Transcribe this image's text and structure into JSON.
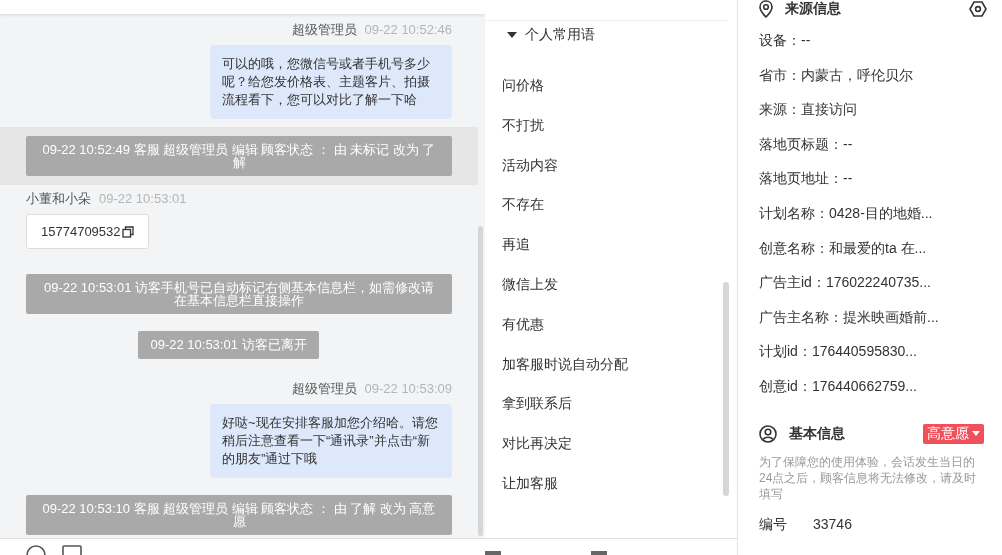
{
  "messages": [
    {
      "kind": "agent",
      "sender": "超级管理员",
      "time": "09-22 10:52:46",
      "text": "可以的哦，您微信号或者手机号多少呢？给您发价格表、主题客片、拍摄流程看下，您可以对比了解一下哈"
    },
    {
      "kind": "system",
      "highlighted": true,
      "text": "09-22 10:52:49 客服 超级管理员 编辑 顾客状态 ： 由 未标记 改为 了解"
    },
    {
      "kind": "visitor",
      "sender": "小董和小朵",
      "time": "09-22 10:53:01",
      "phone": "15774709532"
    },
    {
      "kind": "system",
      "highlighted": false,
      "text": "09-22 10:53:01 访客手机号已自动标记右侧基本信息栏，如需修改请在基本信息栏直接操作"
    },
    {
      "kind": "notice",
      "text": "09-22 10:53:01 访客已离开"
    },
    {
      "kind": "agent",
      "sender": "超级管理员",
      "time": "09-22 10:53:09",
      "text": "好哒~现在安排客服加您介绍哈。请您稍后注意查看一下“通讯录”并点击“新的朋友”通过下哦"
    },
    {
      "kind": "system",
      "highlighted": false,
      "text": "09-22 10:53:10 客服 超级管理员 编辑 顾客状态 ： 由 了解 改为 高意愿"
    }
  ],
  "phrases": {
    "title": "个人常用语",
    "expanded": true,
    "items": [
      "问价格",
      "不打扰",
      "活动内容",
      "不存在",
      "再追",
      "微信上发",
      "有优惠",
      "加客服时说自动分配",
      "拿到联系后",
      "对比再决定",
      "让加客服"
    ]
  },
  "source_info": {
    "title": "来源信息",
    "fields": [
      "设备：--",
      "省市：内蒙古，呼伦贝尔",
      "来源：直接访问",
      "落地页标题：--",
      "落地页地址：--",
      "计划名称：0428-目的地婚...",
      "创意名称：和最爱的ta 在...",
      "广告主id：176022240735...",
      "广告主名称：提米映画婚前...",
      "计划id：176440595830...",
      "创意id：176440662759..."
    ]
  },
  "basic_info": {
    "title": "基本信息",
    "status": {
      "label": "高意愿",
      "color": "#f0505a"
    },
    "note": "为了保障您的使用体验，会话发生当日的24点之后，顾客信息将无法修改，请及时填写",
    "fields": [
      {
        "label": "编号",
        "value": "33746"
      }
    ]
  }
}
